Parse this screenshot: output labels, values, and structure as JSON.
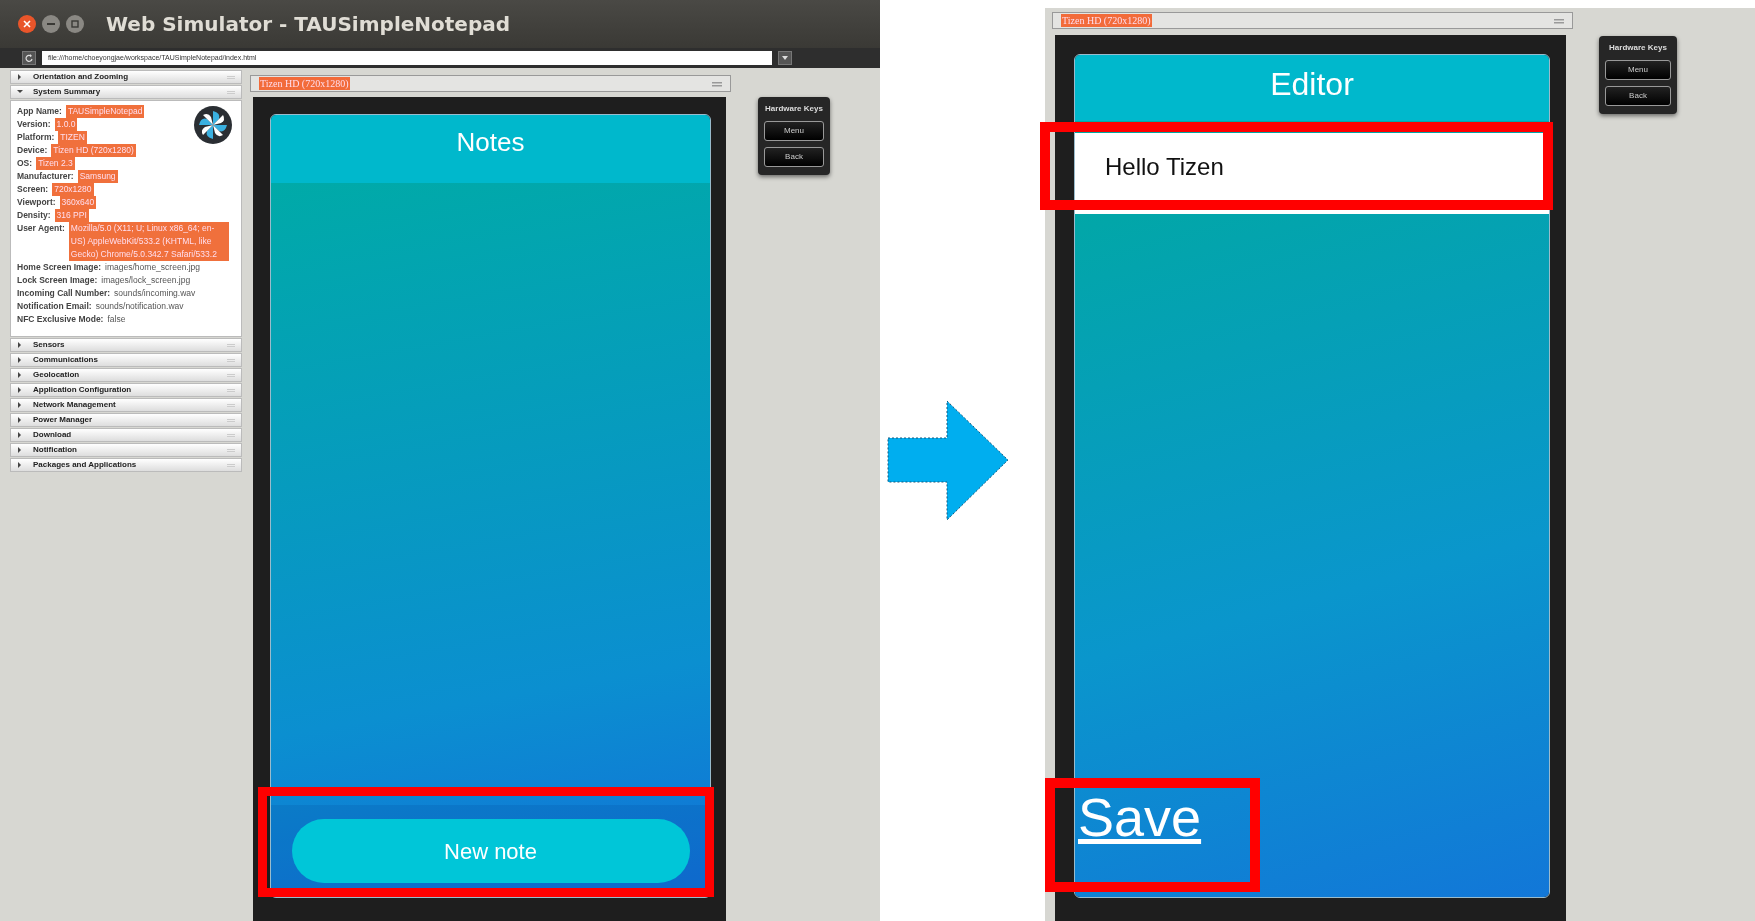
{
  "left_screenshot": {
    "window_title": "Web Simulator - TAUSimpleNotepad",
    "address": "file:///home/choeyongjae/workspace/TAUSimpleNotepad/index.html",
    "sidebar": [
      {
        "label": "Orientation and Zooming",
        "expanded": false
      },
      {
        "label": "System Summary",
        "expanded": true,
        "fields": [
          {
            "label": "App Name:",
            "value": "TAUSimpleNotepad",
            "highlighted": true
          },
          {
            "label": "Version:",
            "value": "1.0.0",
            "highlighted": true
          },
          {
            "label": "Platform:",
            "value": "TIZEN",
            "highlighted": true
          },
          {
            "label": "Device:",
            "value": "Tizen HD (720x1280)",
            "highlighted": true
          },
          {
            "label": "OS:",
            "value": "Tizen 2.3",
            "highlighted": true
          },
          {
            "label": "Manufacturer:",
            "value": "Samsung",
            "highlighted": true
          },
          {
            "label": "Screen:",
            "value": "720x1280",
            "highlighted": true
          },
          {
            "label": "Viewport:",
            "value": "360x640",
            "highlighted": true
          },
          {
            "label": "Density:",
            "value": "316 PPI",
            "highlighted": true
          },
          {
            "label": "User Agent:",
            "value": "Mozilla/5.0 (X11; U; Linux x86_64; en-US) AppleWebKit/533.2 (KHTML, like Gecko) Chrome/5.0.342.7 Safari/533.2",
            "highlighted": true
          },
          {
            "label": "Home Screen Image:",
            "value": "images/home_screen.jpg",
            "highlighted": false
          },
          {
            "label": "Lock Screen Image:",
            "value": "images/lock_screen.jpg",
            "highlighted": false
          },
          {
            "label": "Incoming Call Number:",
            "value": "sounds/incoming.wav",
            "highlighted": false
          },
          {
            "label": "Notification Email:",
            "value": "sounds/notification.wav",
            "highlighted": false
          },
          {
            "label": "NFC Exclusive Mode:",
            "value": "false",
            "highlighted": false
          }
        ]
      },
      {
        "label": "Sensors",
        "expanded": false
      },
      {
        "label": "Communications",
        "expanded": false
      },
      {
        "label": "Geolocation",
        "expanded": false
      },
      {
        "label": "Application Configuration",
        "expanded": false
      },
      {
        "label": "Network Management",
        "expanded": false
      },
      {
        "label": "Power Manager",
        "expanded": false
      },
      {
        "label": "Download",
        "expanded": false
      },
      {
        "label": "Notification",
        "expanded": false
      },
      {
        "label": "Packages and Applications",
        "expanded": false
      }
    ],
    "device_label": "Tizen HD (720x1280)",
    "app": {
      "title": "Notes",
      "button": "New note"
    },
    "hardware_keys": {
      "title": "Hardware Keys",
      "buttons": [
        "Menu",
        "Back"
      ]
    }
  },
  "right_screenshot": {
    "device_label": "Tizen HD (720x1280)",
    "app": {
      "title": "Editor",
      "note_text": "Hello Tizen",
      "save_link": "Save"
    },
    "hardware_keys": {
      "title": "Hardware Keys",
      "buttons": [
        "Menu",
        "Back"
      ]
    }
  }
}
